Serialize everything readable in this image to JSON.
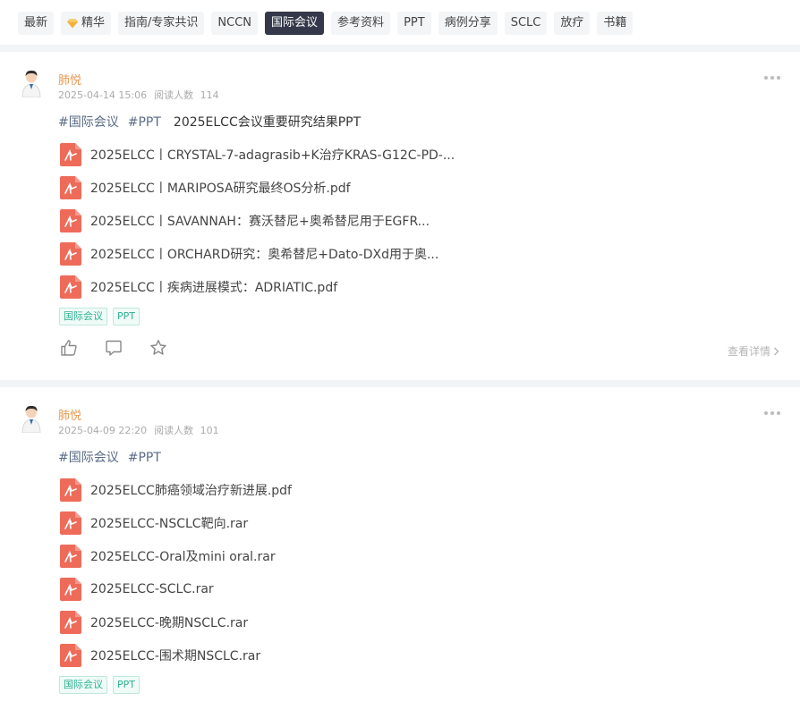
{
  "tabs": [
    {
      "label": "最新",
      "icon": ""
    },
    {
      "label": "精华",
      "icon": "gem-icon"
    },
    {
      "label": "指南/专家共识",
      "icon": ""
    },
    {
      "label": "NCCN",
      "icon": ""
    },
    {
      "label": "国际会议",
      "icon": "",
      "active": true
    },
    {
      "label": "参考资料",
      "icon": ""
    },
    {
      "label": "PPT",
      "icon": ""
    },
    {
      "label": "病例分享",
      "icon": ""
    },
    {
      "label": "SCLC",
      "icon": ""
    },
    {
      "label": "放疗",
      "icon": ""
    },
    {
      "label": "书籍",
      "icon": ""
    }
  ],
  "posts": [
    {
      "author": "肺悦",
      "date": "2025-04-14 15:06",
      "reads_label": "阅读人数",
      "reads": "114",
      "hashtags": [
        "#国际会议",
        "#PPT"
      ],
      "title": "2025ELCC会议重要研究结果PPT",
      "files": [
        "2025ELCC丨CRYSTAL-7-adagrasib+K治疗KRAS-G12C-PD-...",
        "2025ELCC丨MARIPOSA研究最终OS分析.pdf",
        "2025ELCC丨SAVANNAH：赛沃替尼+奥希替尼用于EGFR...",
        "2025ELCC丨ORCHARD研究：奥希替尼+Dato-DXd用于奥...",
        "2025ELCC丨疾病进展模式：ADRIATIC.pdf"
      ],
      "tags": [
        "国际会议",
        "PPT"
      ],
      "detail_label": "查看详情"
    },
    {
      "author": "肺悦",
      "date": "2025-04-09 22:20",
      "reads_label": "阅读人数",
      "reads": "101",
      "hashtags": [
        "#国际会议",
        "#PPT"
      ],
      "title": "",
      "files": [
        "2025ELCC肺癌领域治疗新进展.pdf",
        "2025ELCC-NSCLC靶向.rar",
        "2025ELCC-Oral及mini oral.rar",
        "2025ELCC-SCLC.rar",
        "2025ELCC-晚期NSCLC.rar",
        "2025ELCC-围术期NSCLC.rar"
      ],
      "tags": [
        "国际会议",
        "PPT"
      ]
    }
  ],
  "colors": {
    "active_tab": "#34384a",
    "author": "#e79a54",
    "file_icon": "#ee6b5a",
    "tag": "#2fb292"
  }
}
